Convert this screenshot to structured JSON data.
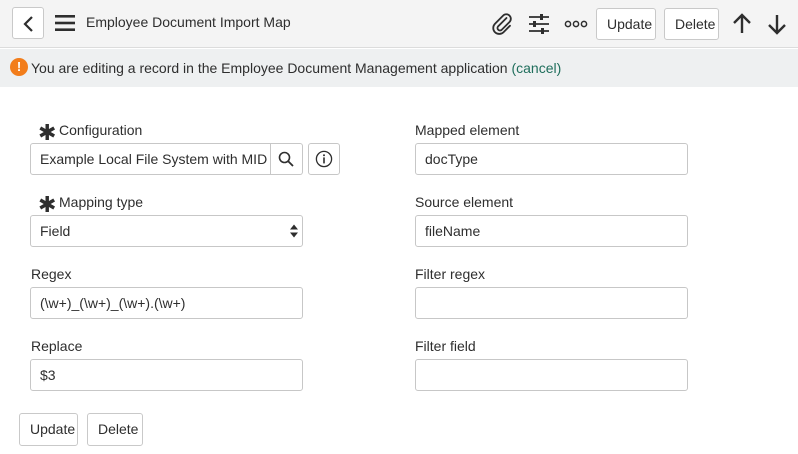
{
  "header": {
    "title": "Employee Document Import Map",
    "update_label": "Update",
    "delete_label": "Delete"
  },
  "notice": {
    "prefix": "You are editing a record in the ",
    "app_name": "Employee Document Management",
    "middle": " application ",
    "cancel_link": "(cancel)",
    "icon_glyph": "!"
  },
  "form": {
    "configuration": {
      "label": "Configuration",
      "value": "Example Local File System with MID Serv"
    },
    "mapping_type": {
      "label": "Mapping type",
      "value": "Field"
    },
    "regex": {
      "label": "Regex",
      "value": "(\\w+)_(\\w+)_(\\w+).(\\w+)"
    },
    "replace": {
      "label": "Replace",
      "value": "$3"
    },
    "mapped_element": {
      "label": "Mapped element",
      "value": "docType"
    },
    "source_element": {
      "label": "Source element",
      "value": "fileName"
    },
    "filter_regex": {
      "label": "Filter regex",
      "value": ""
    },
    "filter_field": {
      "label": "Filter field",
      "value": ""
    },
    "required_mark": "✱"
  },
  "footer": {
    "update_label": "Update",
    "delete_label": "Delete"
  },
  "colors": {
    "notice_icon": "#f27d1b",
    "link": "#1f6e5c",
    "header_bg": "#f4f4f4",
    "notice_bg": "#eef0f1"
  }
}
